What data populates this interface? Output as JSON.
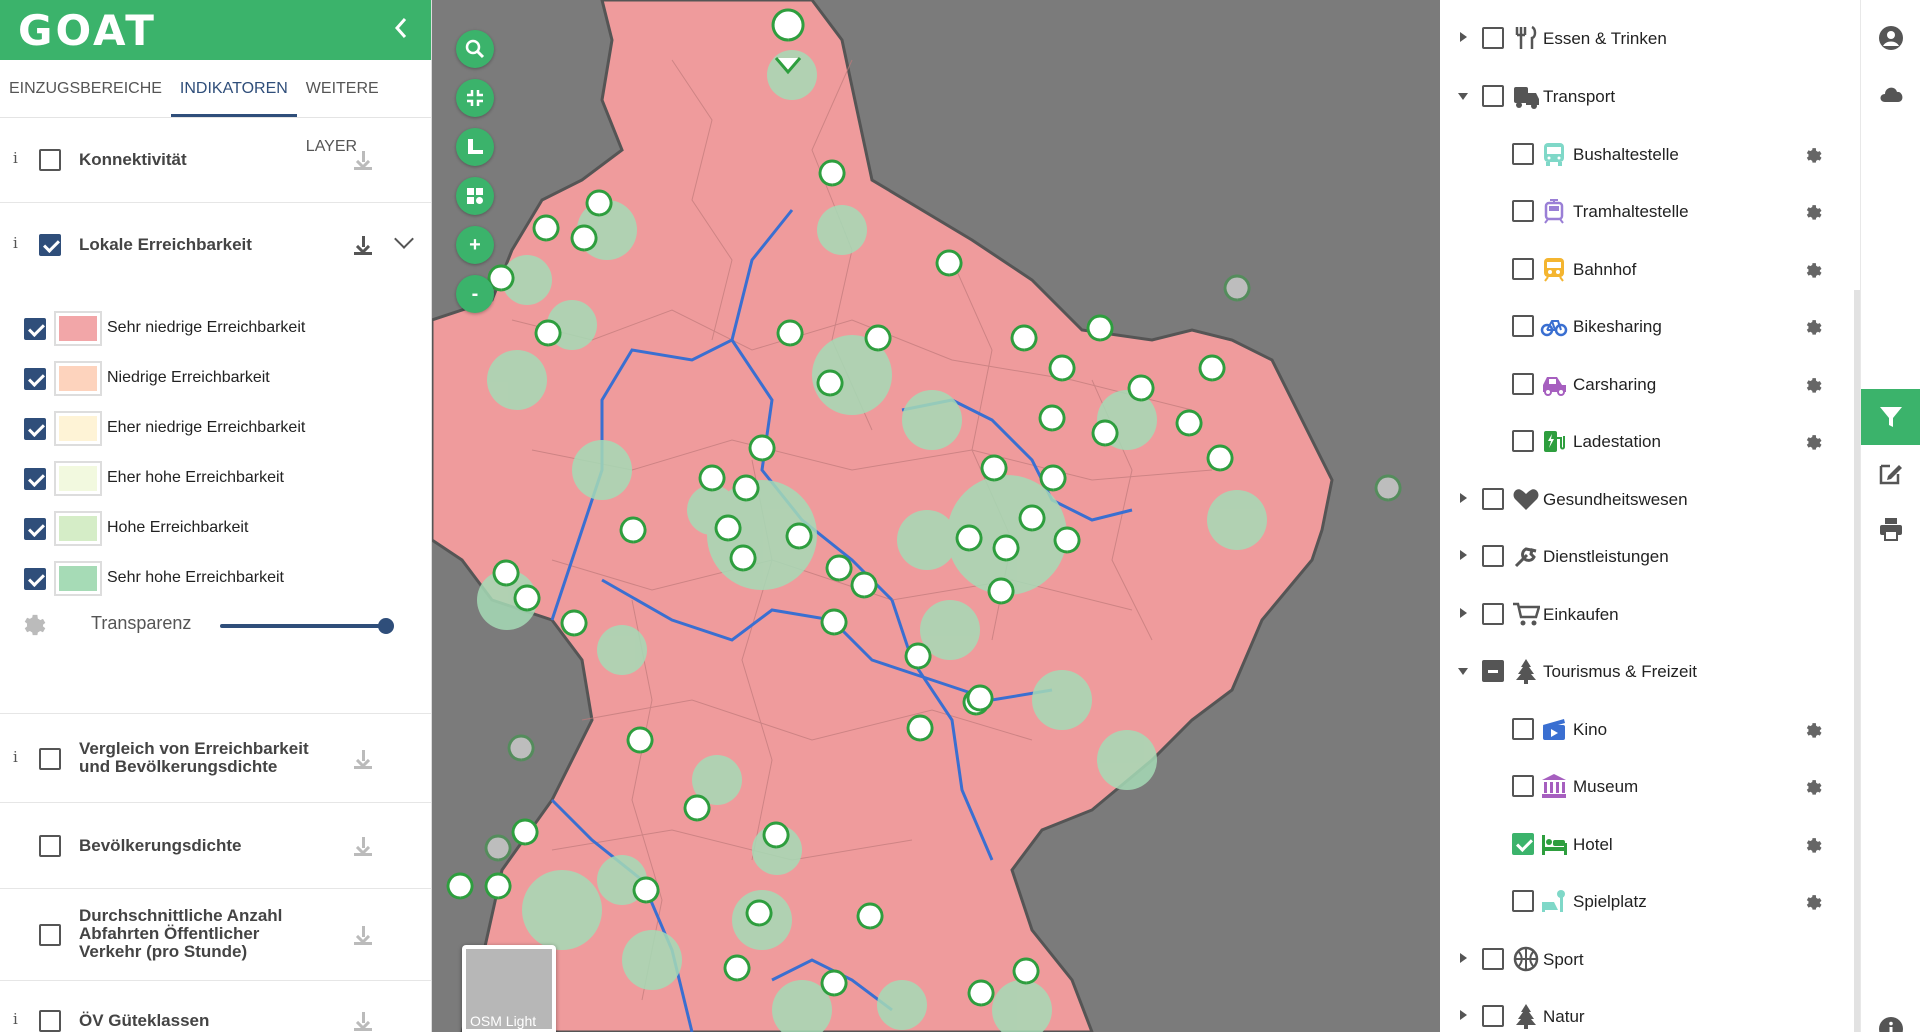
{
  "brand": {
    "logo": "GOAT",
    "collapse_icon": "chevron-left-icon"
  },
  "tabs": [
    {
      "label": "EINZUGSBEREICHE",
      "active": false
    },
    {
      "label": "INDIKATOREN",
      "active": true
    },
    {
      "label": "WEITERE LAYER",
      "active": false
    }
  ],
  "indicators": {
    "info_glyph": "i",
    "konnektivitaet": {
      "label": "Konnektivität",
      "checked": false
    },
    "lokale": {
      "label": "Lokale Erreichbarkeit",
      "checked": true
    },
    "vergleich": {
      "label": "Vergleich von Erreichbarkeit und Bevölkerungsdichte",
      "checked": false
    },
    "bevoelkerung": {
      "label": "Bevölkerungsdichte",
      "checked": false
    },
    "abfahrten": {
      "label": "Durchschnittliche Anzahl Abfahrten Öffentlicher Verkehr (pro Stunde)",
      "checked": false
    },
    "oev": {
      "label": "ÖV Güteklassen",
      "checked": false
    }
  },
  "legend": {
    "items": [
      {
        "label": "Sehr niedrige Erreichbarkeit",
        "color": "#f2a6a8",
        "checked": true
      },
      {
        "label": "Niedrige Erreichbarkeit",
        "color": "#fdd3bd",
        "checked": true
      },
      {
        "label": "Eher niedrige Erreichbarkeit",
        "color": "#fef3d6",
        "checked": true
      },
      {
        "label": "Eher hohe Erreichbarkeit",
        "color": "#f2f9df",
        "checked": true
      },
      {
        "label": "Hohe Erreichbarkeit",
        "color": "#d5edc7",
        "checked": true
      },
      {
        "label": "Sehr hohe Erreichbarkeit",
        "color": "#a6dbb6",
        "checked": true
      }
    ],
    "transparency_label": "Transparenz",
    "transparency_value": 1.0
  },
  "map": {
    "controls": [
      {
        "name": "search-icon",
        "glyph": "⌕"
      },
      {
        "name": "fullscreen-exit-icon",
        "glyph": "⤡"
      },
      {
        "name": "measure-icon",
        "glyph": "📏"
      },
      {
        "name": "map-style-icon",
        "glyph": "▚"
      },
      {
        "name": "zoom-in-icon",
        "glyph": "+"
      },
      {
        "name": "zoom-out-icon",
        "glyph": "-"
      }
    ],
    "basemap_label": "OSM Light",
    "colors": {
      "area": "#ef9b9c",
      "outside": "#7b7b7b",
      "boundary": "#3a6fd1",
      "marker": "#2e9e3e"
    }
  },
  "poi": {
    "categories": [
      {
        "label": "Essen & Trinken",
        "icon": "cutlery-icon",
        "expanded": false,
        "state": "off"
      },
      {
        "label": "Transport",
        "icon": "transport-icon",
        "expanded": true,
        "state": "off"
      },
      {
        "label": "Gesundheitswesen",
        "icon": "heart-icon",
        "expanded": false,
        "state": "off"
      },
      {
        "label": "Dienstleistungen",
        "icon": "wrench-icon",
        "expanded": false,
        "state": "off"
      },
      {
        "label": "Einkaufen",
        "icon": "cart-icon",
        "expanded": false,
        "state": "off"
      },
      {
        "label": "Tourismus & Freizeit",
        "icon": "tree-icon",
        "expanded": true,
        "state": "indeterminate"
      },
      {
        "label": "Sport",
        "icon": "ball-icon",
        "expanded": false,
        "state": "off"
      },
      {
        "label": "Natur",
        "icon": "pine-icon",
        "expanded": false,
        "state": "off"
      }
    ],
    "transport_items": [
      {
        "label": "Bushaltestelle",
        "icon": "bus-icon",
        "color": "#7fd8c8",
        "checked": false
      },
      {
        "label": "Tramhaltestelle",
        "icon": "tram-icon",
        "color": "#9a7fd6",
        "checked": false
      },
      {
        "label": "Bahnhof",
        "icon": "train-icon",
        "color": "#f4b530",
        "checked": false
      },
      {
        "label": "Bikesharing",
        "icon": "bike-icon",
        "color": "#3a6fd1",
        "checked": false
      },
      {
        "label": "Carsharing",
        "icon": "car-icon",
        "color": "#a65fbf",
        "checked": false
      },
      {
        "label": "Ladestation",
        "icon": "charging-icon",
        "color": "#2e9e3e",
        "checked": false
      }
    ],
    "tourism_items": [
      {
        "label": "Kino",
        "icon": "film-icon",
        "color": "#3a6fd1",
        "checked": false
      },
      {
        "label": "Museum",
        "icon": "museum-icon",
        "color": "#a65fbf",
        "checked": false
      },
      {
        "label": "Hotel",
        "icon": "bed-icon",
        "color": "#2e9e3e",
        "checked": true
      },
      {
        "label": "Spielplatz",
        "icon": "playground-icon",
        "color": "#7fd8c8",
        "checked": false
      }
    ]
  },
  "rail": [
    {
      "name": "account-icon",
      "active": false
    },
    {
      "name": "cloud-icon",
      "active": false
    },
    {
      "name": "filter-icon",
      "active": true
    },
    {
      "name": "edit-icon",
      "active": false
    },
    {
      "name": "print-icon",
      "active": false
    },
    {
      "name": "info-icon",
      "active": false
    }
  ]
}
